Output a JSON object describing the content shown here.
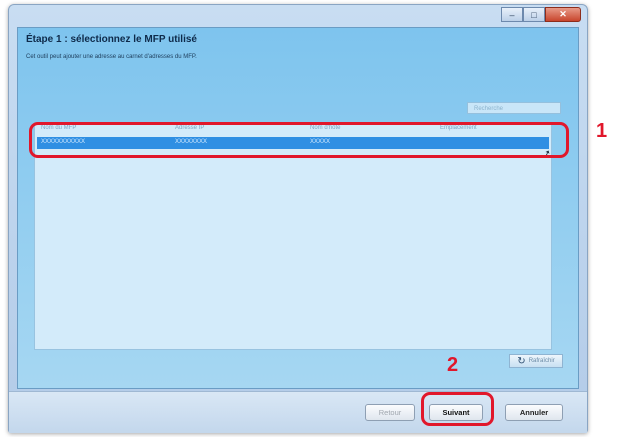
{
  "window": {
    "close_glyph": "✕",
    "min_glyph": "–",
    "max_glyph": "□"
  },
  "step_title": "Étape 1 : sélectionnez le MFP utilisé",
  "description": "Cet outil peut ajouter une adresse au carnet d'adresses du MFP.",
  "search": {
    "placeholder": "Recherche"
  },
  "table": {
    "columns": [
      "Nom du MFP",
      "Adresse IP",
      "Nom d'hôte",
      "Emplacement"
    ],
    "rows": [
      {
        "cells": [
          "XXXXXXXXXXX",
          "XXXXXXXX",
          "XXXXX",
          ""
        ]
      }
    ]
  },
  "refresh_label": "Rafraîchir",
  "buttons": {
    "back": "Retour",
    "next": "Suivant",
    "cancel": "Annuler"
  },
  "annotations": {
    "marker_1": "1",
    "marker_2": "2"
  },
  "colors": {
    "callout": "#e1172b",
    "selection": "#2f8fe3",
    "panel": "#7ec4ee"
  },
  "icons": {
    "refresh": "refresh-icon",
    "cursor": "mouse-pointer-icon",
    "close": "close-icon"
  }
}
